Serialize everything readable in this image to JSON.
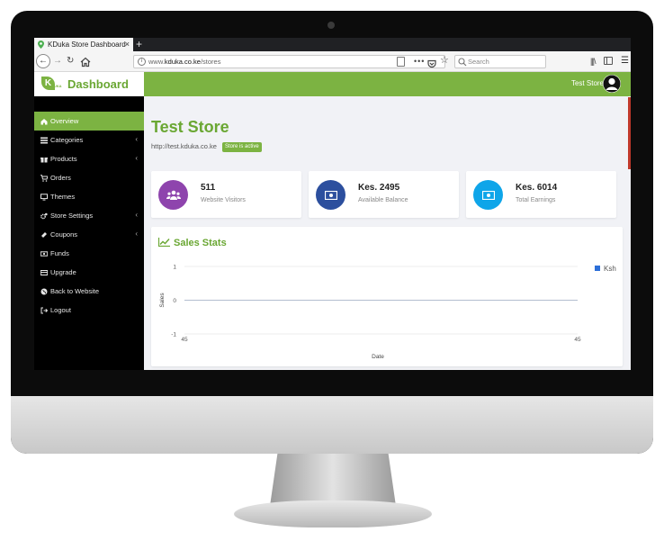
{
  "browser": {
    "tab_title": "KDuka Store Dashboard",
    "tab_close": "×",
    "new_tab": "+",
    "url_prefix": "www.",
    "url_host": "kduka.co.ke",
    "url_path": "/stores",
    "search_placeholder": "Search"
  },
  "brand": {
    "logo_letter": "K",
    "logo_sub": "DUKA",
    "title": "Dashboard",
    "color": "#7cb342"
  },
  "header": {
    "user_name": "Test Store"
  },
  "sidebar": {
    "items": [
      {
        "label": "Overview",
        "icon": "home-icon",
        "active": true,
        "caret": false
      },
      {
        "label": "Categories",
        "icon": "list-icon",
        "active": false,
        "caret": true
      },
      {
        "label": "Products",
        "icon": "gift-icon",
        "active": false,
        "caret": true
      },
      {
        "label": "Orders",
        "icon": "cart-icon",
        "active": false,
        "caret": false
      },
      {
        "label": "Themes",
        "icon": "desktop-icon",
        "active": false,
        "caret": false
      },
      {
        "label": "Store Settings",
        "icon": "cogs-icon",
        "active": false,
        "caret": true
      },
      {
        "label": "Coupons",
        "icon": "ticket-icon",
        "active": false,
        "caret": true
      },
      {
        "label": "Funds",
        "icon": "money-icon",
        "active": false,
        "caret": false
      },
      {
        "label": "Upgrade",
        "icon": "credit-card-icon",
        "active": false,
        "caret": false
      },
      {
        "label": "Back to Website",
        "icon": "globe-icon",
        "active": false,
        "caret": false
      },
      {
        "label": "Logout",
        "icon": "sign-out-icon",
        "active": false,
        "caret": false
      }
    ]
  },
  "main": {
    "title": "Test Store",
    "store_url": "http://test.kduka.co.ke",
    "status_badge": "Store is active"
  },
  "stats": [
    {
      "value": "511",
      "label": "Website Visitors",
      "icon": "users-icon",
      "color": "#8e44ad"
    },
    {
      "value": "Kes. 2495",
      "label": "Available Balance",
      "icon": "money-icon",
      "color": "#2c4f9e"
    },
    {
      "value": "Kes. 6014",
      "label": "Total Earnings",
      "icon": "money-icon",
      "color": "#0ea5e9"
    }
  ],
  "chart_panel": {
    "title": "Sales Stats"
  },
  "chart_data": {
    "type": "line",
    "x": [
      "45",
      "45"
    ],
    "series": [
      {
        "name": "Ksh",
        "values": [
          0,
          0
        ],
        "color": "#2d6fd8"
      }
    ],
    "ytick_labels": [
      "1",
      "0",
      "-1"
    ],
    "ylim": [
      -1,
      1
    ],
    "xlabel": "Date",
    "ylabel": "Sales",
    "grid": true,
    "legend": "top-right"
  }
}
